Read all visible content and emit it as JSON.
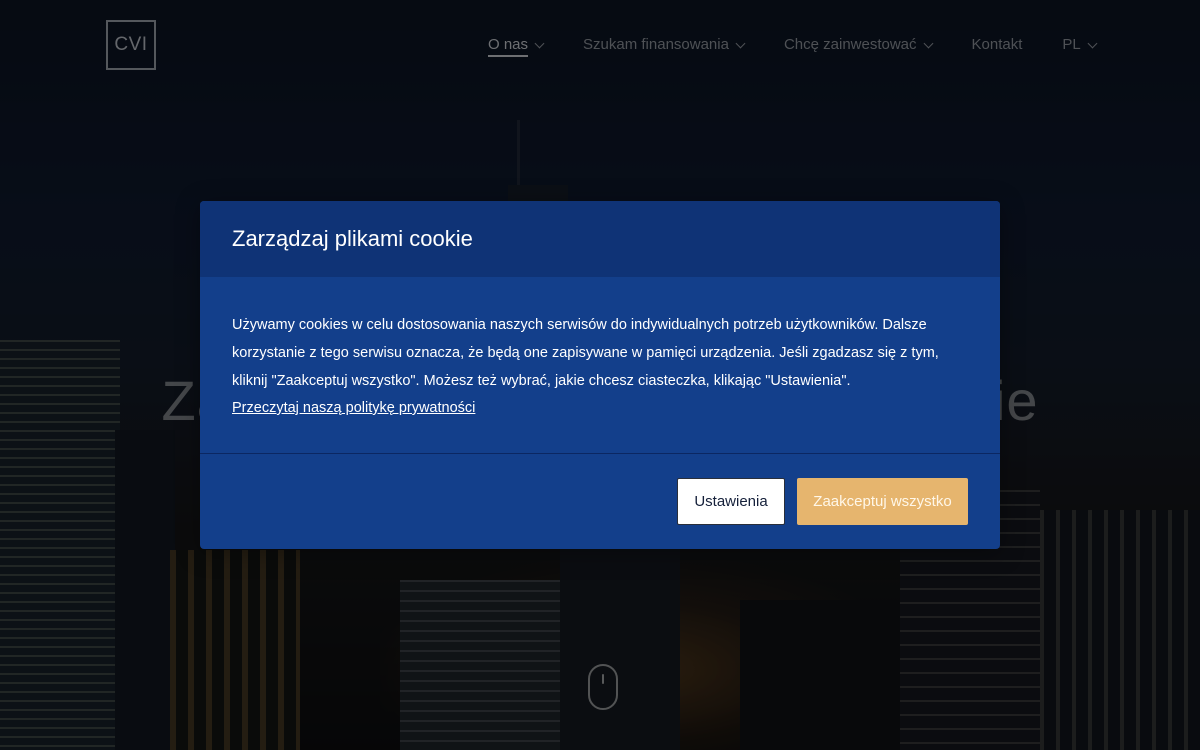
{
  "header": {
    "logo_text": "CVI",
    "nav": [
      {
        "label": "O nas",
        "has_dropdown": true,
        "active": true
      },
      {
        "label": "Szukam finansowania",
        "has_dropdown": true
      },
      {
        "label": "Chcę zainwestować",
        "has_dropdown": true
      },
      {
        "label": "Kontakt",
        "has_dropdown": false
      },
      {
        "label": "PL",
        "has_dropdown": true
      }
    ]
  },
  "hero": {
    "title_left": "Za",
    "title_right": "nie"
  },
  "cookie_modal": {
    "title": "Zarządzaj plikami cookie",
    "body": "Używamy cookies w celu dostosowania naszych serwisów do indywidualnych potrzeb użytkowników. Dalsze korzystanie z tego serwisu oznacza, że będą one zapisywane w pamięci urządzenia. Jeśli zgadzasz się z tym, kliknij \"Zaakceptuj wszystko\". Możesz też wybrać, jakie chcesz ciasteczka, klikając \"Ustawienia\".",
    "privacy_link": "Przeczytaj naszą politykę prywatności",
    "settings_button": "Ustawienia",
    "accept_button": "Zaakceptuj wszystko"
  },
  "colors": {
    "modal_bg": "#133f8b",
    "modal_header_bg": "#0f3376",
    "accept_button_bg": "#e6b56e"
  },
  "icons": {
    "dropdown": "chevron-down-icon",
    "scroll": "mouse-scroll-icon"
  }
}
